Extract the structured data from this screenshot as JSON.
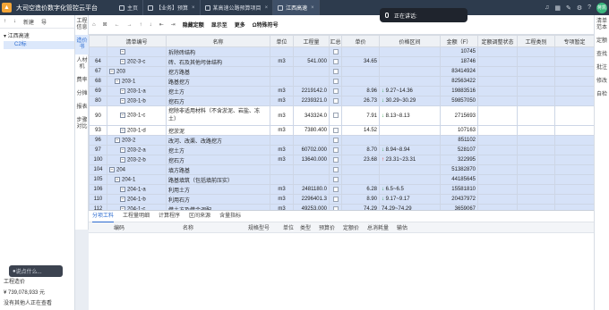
{
  "titlebar": {
    "app_title": "大司空造价数字化管控云平台",
    "tabs": [
      {
        "label": "主页",
        "close": ""
      },
      {
        "label": "【业务】预算",
        "close": "×"
      },
      {
        "label": "某高速公路预算项目",
        "close": "×"
      },
      {
        "label": "江西高速",
        "close": "×"
      }
    ],
    "recording": "正在讲话:",
    "avatar": "蒋凯"
  },
  "left_panel": {
    "toolbar": [
      "新建",
      "导"
    ],
    "tree_root": "江西高速",
    "tree_child": "C2标",
    "cost_label": "工程造价",
    "cost_value": "¥ 739,078,933 元",
    "viewers": "没有其他人正在查看",
    "voice_placeholder": "说点什么..."
  },
  "vtabs": [
    "工程信息",
    "造价书",
    "人材机",
    "费率",
    "分摊",
    "报表",
    "步骤对比"
  ],
  "right_panel": [
    "清单范本",
    "定额",
    "查找",
    "批注",
    "修改",
    "自检"
  ],
  "toolbar": [
    "隐藏定额",
    "显示至",
    "更多",
    "Ω特殊符号"
  ],
  "grid": {
    "headers": [
      "",
      "清单编号",
      "名称",
      "单位",
      "工程量",
      "汇总",
      "单价",
      "价格区间",
      "金额（F）",
      "定额调整状态",
      "工程类别",
      "专项暂定"
    ],
    "rows": [
      {
        "n": "",
        "code": "",
        "name": "拆除砖结构",
        "unit": "",
        "qty": "",
        "price": "",
        "range": "",
        "dir": "",
        "amount": "10745",
        "lvl": 2,
        "band": true
      },
      {
        "n": "64",
        "code": "202-3-c",
        "name": "砖、石及其他圬体结构",
        "unit": "m3",
        "qty": "541.000",
        "price": "34.65",
        "range": "",
        "dir": "",
        "amount": "18746",
        "lvl": 2,
        "band": true
      },
      {
        "n": "67",
        "code": "203",
        "name": "挖方路基",
        "unit": "",
        "qty": "",
        "price": "",
        "range": "",
        "dir": "",
        "amount": "83414924",
        "lvl": 0,
        "band": true
      },
      {
        "n": "68",
        "code": "203-1",
        "name": "路基挖方",
        "unit": "",
        "qty": "",
        "price": "",
        "range": "",
        "dir": "",
        "amount": "82563422",
        "lvl": 1,
        "band": true
      },
      {
        "n": "69",
        "code": "203-1-a",
        "name": "挖土方",
        "unit": "m3",
        "qty": "2219142.0",
        "price": "8.96",
        "range": "9.27~14.36",
        "dir": "dn",
        "amount": "19883516",
        "lvl": 2,
        "band": true
      },
      {
        "n": "80",
        "code": "203-1-b",
        "name": "挖石方",
        "unit": "m3",
        "qty": "2239321.0",
        "price": "26.73",
        "range": "30.29~30.29",
        "dir": "dn",
        "amount": "59857050",
        "lvl": 2,
        "band": true
      },
      {
        "n": "90",
        "code": "203-1-c",
        "name": "挖除非适用材料（不含淤泥、岩盐、冻土）",
        "unit": "m3",
        "qty": "343324.0",
        "price": "7.91",
        "range": "8.13~8.13",
        "dir": "dn",
        "amount": "2715693",
        "lvl": 2,
        "band": false,
        "tall": true
      },
      {
        "n": "93",
        "code": "203-1-d",
        "name": "挖淤泥",
        "unit": "m3",
        "qty": "7380.400",
        "price": "14.52",
        "range": "",
        "dir": "",
        "amount": "107163",
        "lvl": 2,
        "band": false
      },
      {
        "n": "96",
        "code": "203-2",
        "name": "改河、改渠、改路挖方",
        "unit": "",
        "qty": "",
        "price": "",
        "range": "",
        "dir": "",
        "amount": "851102",
        "lvl": 1,
        "band": true
      },
      {
        "n": "97",
        "code": "203-2-a",
        "name": "挖土方",
        "unit": "m3",
        "qty": "60702.000",
        "price": "8.70",
        "range": "8.94~8.94",
        "dir": "dn",
        "amount": "528107",
        "lvl": 2,
        "band": true
      },
      {
        "n": "100",
        "code": "203-2-b",
        "name": "挖石方",
        "unit": "m3",
        "qty": "13640.000",
        "price": "23.68",
        "range": "23.31~23.31",
        "dir": "up",
        "amount": "322995",
        "lvl": 2,
        "band": true
      },
      {
        "n": "104",
        "code": "204",
        "name": "填方路基",
        "unit": "",
        "qty": "",
        "price": "",
        "range": "",
        "dir": "",
        "amount": "51382870",
        "lvl": 0,
        "band": true
      },
      {
        "n": "105",
        "code": "204-1",
        "name": "路基填筑（包括填前压实）",
        "unit": "",
        "qty": "",
        "price": "",
        "range": "",
        "dir": "",
        "amount": "44185645",
        "lvl": 1,
        "band": true
      },
      {
        "n": "106",
        "code": "204-1-a",
        "name": "利用土方",
        "unit": "m3",
        "qty": "2481180.0",
        "price": "6.28",
        "range": "6.5~6.5",
        "dir": "dn",
        "amount": "15581810",
        "lvl": 2,
        "band": true
      },
      {
        "n": "110",
        "code": "204-1-b",
        "name": "利用石方",
        "unit": "m3",
        "qty": "2296401.3",
        "price": "8.90",
        "range": "9.17~9.17",
        "dir": "dn",
        "amount": "20437972",
        "lvl": 2,
        "band": true
      },
      {
        "n": "112",
        "code": "204-1-c",
        "name": "借土方及借余调配",
        "unit": "m3",
        "qty": "49253.000",
        "price": "74.29",
        "range": "74.29~74.29",
        "dir": "",
        "amount": "3659067",
        "lvl": 2,
        "band": true
      }
    ]
  },
  "bottom": {
    "tabs": [
      "分项工料",
      "工程量明细",
      "计算程序",
      "区间来源",
      "含量指标"
    ],
    "headers": [
      "编码",
      "名称",
      "规格型号",
      "单位",
      "类型",
      "预算价",
      "定额价",
      "总消耗量",
      "输估"
    ]
  }
}
